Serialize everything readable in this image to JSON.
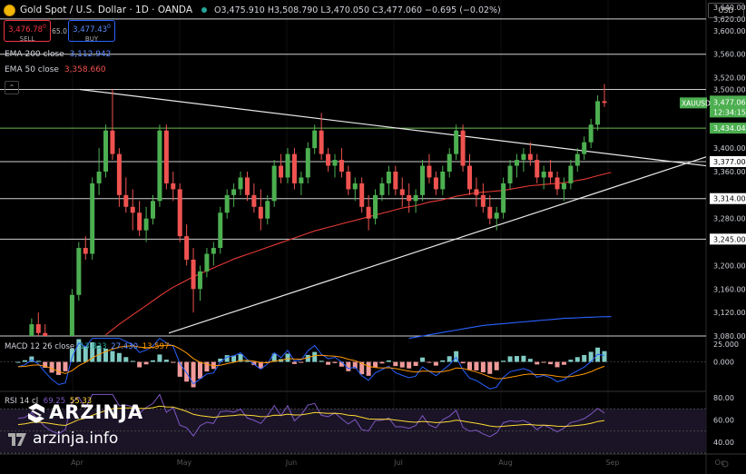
{
  "header": {
    "symbol": "Gold Spot / U.S. Dollar · 1D · OANDA",
    "ohlc": "O3,475.910 H3,508.790 L3,470.050 C3,477.060 −0.695 (−0.02%)"
  },
  "trade": {
    "sell_price": "3,476.78",
    "sell_sup": "0",
    "sell_label": "SELL",
    "spread": "65.0",
    "buy_price": "3,477.43",
    "buy_sup": "0",
    "buy_label": "BUY"
  },
  "indicators": {
    "ema200_label": "EMA 200 close",
    "ema200_value": "3,112.942",
    "ema50_label": "EMA 50 close",
    "ema50_value": "3,358.660",
    "macd_label": "MACD 12 26 close",
    "macd_values": [
      "13.833",
      "27.430",
      "13.597"
    ],
    "rsi_label": "RSI 14 cl",
    "rsi_values": [
      "69.25",
      "55.33"
    ]
  },
  "currency_button": "USD",
  "brand": {
    "name": "ARZINJA",
    "url": "arzinja.info"
  },
  "colors": {
    "up": "#4caf50",
    "down": "#ef5350",
    "ema200": "#2962ff",
    "ema50": "#e53935",
    "macd": "#2962ff",
    "signal": "#ff9800",
    "rsi": "#7e57c2",
    "rsi_ma": "#fdd835"
  },
  "chart_data": {
    "type": "candlestick",
    "symbol_label": "XAUUSD",
    "last_price": "3,477.060",
    "countdown": "12:34:15",
    "level_labels": [
      "3,434.046",
      "3,377.000",
      "3,314.000",
      "3,245.000"
    ],
    "axis_labels": [
      "3,640.000",
      "3,620.000",
      "3,600.000",
      "3,560.000",
      "3,520.000",
      "3,500.000",
      "3,400.000",
      "3,360.000",
      "3,280.000",
      "3,200.000",
      "3,160.000",
      "3,120.000",
      "3,080.000"
    ],
    "hlines": [
      3620,
      3560,
      3500,
      3434.046,
      3377,
      3314,
      3245,
      3080
    ],
    "ylim": [
      3080,
      3640
    ],
    "months": [
      "Apr",
      "May",
      "Jun",
      "Jul",
      "Aug",
      "Sep",
      "Oc"
    ],
    "candles": [
      [
        3035,
        3060,
        3020,
        3055
      ],
      [
        3055,
        3080,
        3040,
        3070
      ],
      [
        3070,
        3110,
        3060,
        3100
      ],
      [
        3100,
        3120,
        3080,
        3085
      ],
      [
        3085,
        3100,
        3040,
        3050
      ],
      [
        3050,
        3070,
        3010,
        3020
      ],
      [
        3020,
        3040,
        2985,
        3000
      ],
      [
        3000,
        3030,
        2970,
        3015
      ],
      [
        3015,
        3160,
        3000,
        3150
      ],
      [
        3150,
        3240,
        3140,
        3230
      ],
      [
        3230,
        3250,
        3210,
        3220
      ],
      [
        3220,
        3350,
        3210,
        3340
      ],
      [
        3340,
        3400,
        3320,
        3360
      ],
      [
        3360,
        3440,
        3350,
        3430
      ],
      [
        3430,
        3500,
        3380,
        3390
      ],
      [
        3390,
        3400,
        3300,
        3320
      ],
      [
        3320,
        3350,
        3290,
        3300
      ],
      [
        3300,
        3330,
        3260,
        3290
      ],
      [
        3290,
        3310,
        3250,
        3260
      ],
      [
        3260,
        3300,
        3240,
        3280
      ],
      [
        3280,
        3320,
        3270,
        3310
      ],
      [
        3310,
        3440,
        3300,
        3430
      ],
      [
        3430,
        3440,
        3330,
        3340
      ],
      [
        3340,
        3360,
        3310,
        3330
      ],
      [
        3330,
        3340,
        3240,
        3250
      ],
      [
        3250,
        3270,
        3200,
        3210
      ],
      [
        3210,
        3230,
        3120,
        3160
      ],
      [
        3160,
        3200,
        3140,
        3190
      ],
      [
        3190,
        3230,
        3180,
        3220
      ],
      [
        3220,
        3240,
        3200,
        3230
      ],
      [
        3230,
        3300,
        3220,
        3290
      ],
      [
        3290,
        3330,
        3280,
        3320
      ],
      [
        3320,
        3340,
        3300,
        3330
      ],
      [
        3330,
        3360,
        3320,
        3350
      ],
      [
        3350,
        3360,
        3310,
        3320
      ],
      [
        3320,
        3340,
        3290,
        3300
      ],
      [
        3300,
        3330,
        3260,
        3280
      ],
      [
        3280,
        3320,
        3270,
        3310
      ],
      [
        3310,
        3380,
        3300,
        3370
      ],
      [
        3370,
        3390,
        3340,
        3350
      ],
      [
        3350,
        3400,
        3340,
        3390
      ],
      [
        3390,
        3400,
        3330,
        3340
      ],
      [
        3340,
        3360,
        3320,
        3350
      ],
      [
        3350,
        3410,
        3340,
        3400
      ],
      [
        3400,
        3440,
        3390,
        3430
      ],
      [
        3430,
        3460,
        3380,
        3390
      ],
      [
        3390,
        3400,
        3360,
        3370
      ],
      [
        3370,
        3390,
        3350,
        3380
      ],
      [
        3380,
        3400,
        3350,
        3360
      ],
      [
        3360,
        3370,
        3320,
        3330
      ],
      [
        3330,
        3350,
        3310,
        3340
      ],
      [
        3340,
        3350,
        3290,
        3300
      ],
      [
        3300,
        3320,
        3260,
        3280
      ],
      [
        3280,
        3330,
        3270,
        3320
      ],
      [
        3320,
        3350,
        3310,
        3340
      ],
      [
        3340,
        3370,
        3320,
        3360
      ],
      [
        3360,
        3370,
        3320,
        3330
      ],
      [
        3330,
        3350,
        3300,
        3320
      ],
      [
        3320,
        3340,
        3290,
        3310
      ],
      [
        3310,
        3330,
        3290,
        3320
      ],
      [
        3320,
        3380,
        3310,
        3370
      ],
      [
        3370,
        3390,
        3340,
        3350
      ],
      [
        3350,
        3360,
        3320,
        3330
      ],
      [
        3330,
        3370,
        3320,
        3360
      ],
      [
        3360,
        3400,
        3350,
        3390
      ],
      [
        3390,
        3440,
        3380,
        3430
      ],
      [
        3430,
        3440,
        3360,
        3370
      ],
      [
        3370,
        3390,
        3320,
        3330
      ],
      [
        3330,
        3350,
        3300,
        3320
      ],
      [
        3320,
        3340,
        3290,
        3300
      ],
      [
        3300,
        3320,
        3270,
        3280
      ],
      [
        3280,
        3300,
        3260,
        3290
      ],
      [
        3290,
        3350,
        3280,
        3340
      ],
      [
        3340,
        3380,
        3330,
        3370
      ],
      [
        3370,
        3390,
        3350,
        3380
      ],
      [
        3380,
        3400,
        3360,
        3390
      ],
      [
        3390,
        3410,
        3370,
        3380
      ],
      [
        3380,
        3390,
        3340,
        3350
      ],
      [
        3350,
        3370,
        3330,
        3360
      ],
      [
        3360,
        3380,
        3340,
        3350
      ],
      [
        3350,
        3360,
        3320,
        3330
      ],
      [
        3330,
        3350,
        3310,
        3340
      ],
      [
        3340,
        3380,
        3330,
        3370
      ],
      [
        3370,
        3400,
        3360,
        3390
      ],
      [
        3390,
        3420,
        3380,
        3410
      ],
      [
        3410,
        3450,
        3400,
        3440
      ],
      [
        3440,
        3490,
        3430,
        3480
      ],
      [
        3480,
        3509,
        3470,
        3477
      ]
    ],
    "ema50": [
      2990,
      2995,
      3000,
      3006,
      3012,
      3018,
      3024,
      3031,
      3038,
      3046,
      3055,
      3064,
      3073,
      3082,
      3091,
      3100,
      3108,
      3116,
      3124,
      3132,
      3140,
      3148,
      3156,
      3163,
      3169,
      3175,
      3181,
      3186,
      3191,
      3196,
      3201,
      3206,
      3211,
      3215,
      3219,
      3223,
      3227,
      3231,
      3235,
      3239,
      3243,
      3247,
      3251,
      3255,
      3259,
      3262,
      3265,
      3268,
      3271,
      3274,
      3277,
      3280,
      3283,
      3286,
      3289,
      3292,
      3295,
      3298,
      3300,
      3302,
      3305,
      3308,
      3310,
      3312,
      3315,
      3318,
      3320,
      3322,
      3324,
      3325,
      3326,
      3327,
      3328,
      3330,
      3332,
      3334,
      3336,
      3337,
      3338,
      3339,
      3340,
      3341,
      3343,
      3345,
      3347,
      3350,
      3353,
      3356,
      3358.66
    ],
    "ema200": [
      2960,
      2962,
      2964,
      2966,
      2968,
      2970,
      2972,
      2974,
      2976,
      2978,
      2980,
      2982,
      2984,
      2986,
      2988,
      2990,
      2992,
      2994,
      2996,
      2998,
      3000,
      3002,
      3004,
      3006,
      3008,
      3010,
      3012,
      3014,
      3016,
      3018,
      3020,
      3022,
      3024,
      3026,
      3028,
      3030,
      3032,
      3034,
      3036,
      3038,
      3040,
      3042,
      3044,
      3046,
      3048,
      3050,
      3052,
      3054,
      3056,
      3058,
      3060,
      3062,
      3064,
      3066,
      3068,
      3070,
      3072,
      3074,
      3076,
      3078,
      3080,
      3082,
      3084,
      3086,
      3088,
      3090,
      3092,
      3094,
      3096,
      3098,
      3099,
      3100,
      3101,
      3102,
      3103,
      3104,
      3105,
      3106,
      3107,
      3108,
      3109,
      3110,
      3110.5,
      3111,
      3111.5,
      3112,
      3112.5,
      3112.8,
      3112.942
    ],
    "macd_axis_labels": [
      "25.000",
      "0.000"
    ],
    "macd_ylim": [
      -40,
      35
    ],
    "rsi_axis_labels": [
      "80.00",
      "60.00",
      "40.00"
    ],
    "rsi_ylim": [
      30,
      85
    ]
  }
}
